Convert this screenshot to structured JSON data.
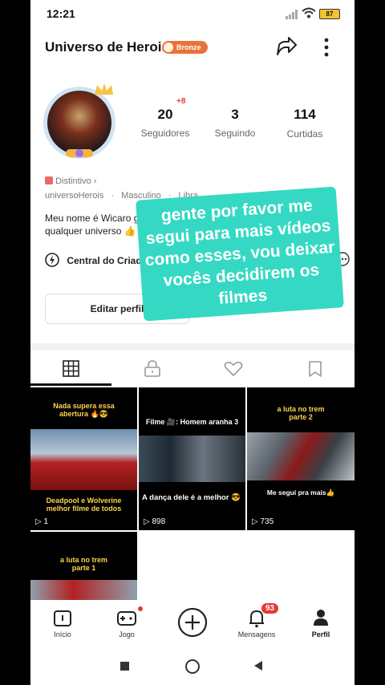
{
  "status": {
    "time": "12:21",
    "battery": "87"
  },
  "header": {
    "title": "Universo de Herois",
    "badge": "Bronze"
  },
  "stats": {
    "seguidores": {
      "value": "20",
      "label": "Seguidores",
      "delta": "+8"
    },
    "seguindo": {
      "value": "3",
      "label": "Seguindo"
    },
    "curtidas": {
      "value": "114",
      "label": "Curtidas"
    }
  },
  "profile": {
    "distintivo": "Distintivo",
    "username": "universoHerois",
    "gender": "Masculino",
    "sign": "Libra",
    "bio_line1": "Meu nome é Wicaro go",
    "bio_line2": "qualquer universo 👍",
    "creator_center": "Central do Criador",
    "edit_profile": "Editar perfil"
  },
  "overlay": {
    "text": "gente por favor me segui para mais vídeos como esses, vou deixar vocês decidirem os filmes"
  },
  "videos": [
    {
      "top_text": "Nada supera essa abertura 🔥😎",
      "bottom_text": "Deadpool e Wolverine melhor filme de todos",
      "plays": "1"
    },
    {
      "top_text": "Filme 🎥: Homem aranha 3",
      "bottom_text": "A dança dele é a melhor 😎",
      "plays": "898"
    },
    {
      "top_text": "a luta no trem parte 2",
      "bottom_text": "Me segui pra mais👍",
      "plays": "735"
    },
    {
      "top_text": "a luta no trem parte 1",
      "bottom_text": "",
      "plays": ""
    }
  ],
  "nav": {
    "inicio": "Início",
    "jogo": "Jogo",
    "mensagens": "Mensagens",
    "mensagens_badge": "93",
    "perfil": "Perfil"
  }
}
